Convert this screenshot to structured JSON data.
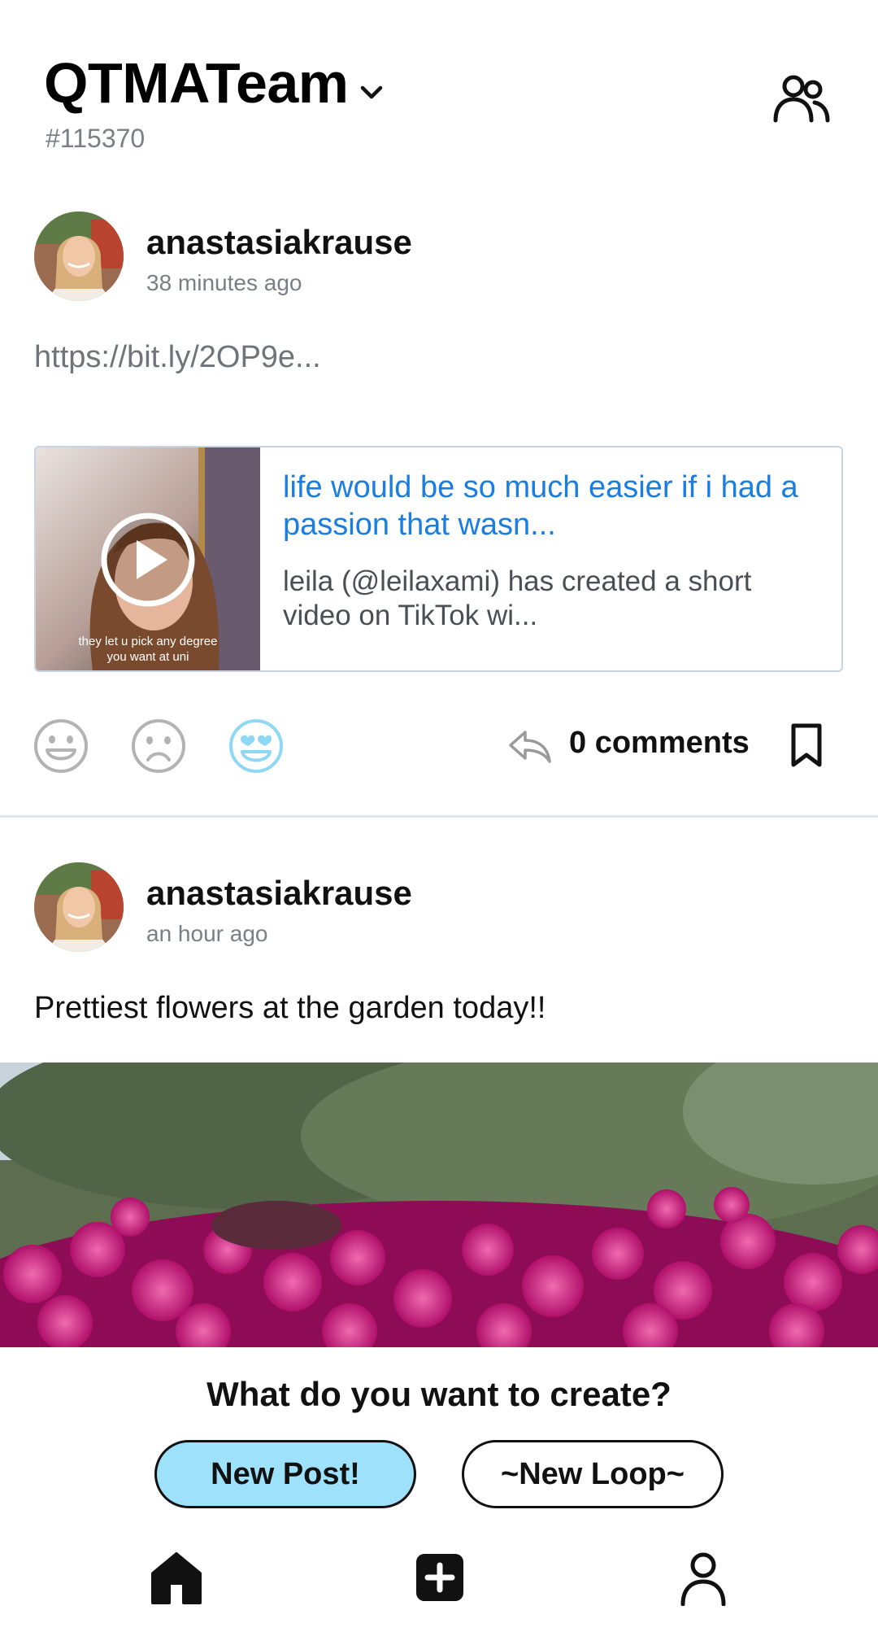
{
  "header": {
    "team_name": "QTMATeam",
    "team_id": "#115370"
  },
  "posts": [
    {
      "author": "anastasiakrause",
      "time": "38 minutes ago",
      "text": "https://bit.ly/2OP9e...",
      "link_preview": {
        "title": "life would be so much easier if i had a passion that wasn...",
        "description": "leila (@leilaxami) has created a short video on TikTok wi...",
        "thumbnail_caption_line1": "they let u pick any degree",
        "thumbnail_caption_line2": "you want at uni"
      },
      "reactions": [
        "smile-icon",
        "sad-icon",
        "heart-eyes-icon"
      ],
      "active_reaction_color": "#8fd8f5",
      "comments_label": "0 comments"
    },
    {
      "author": "anastasiakrause",
      "time": "an hour ago",
      "text": "Prettiest flowers at the garden today!!"
    }
  ],
  "create_sheet": {
    "title": "What do you want to create?",
    "new_post_label": "New Post!",
    "new_loop_label": "~New Loop~"
  },
  "bottom_nav": [
    "home-icon",
    "add-icon",
    "profile-icon"
  ],
  "colors": {
    "accent_blue": "#9ee1fb",
    "link_blue": "#1a7de0"
  }
}
